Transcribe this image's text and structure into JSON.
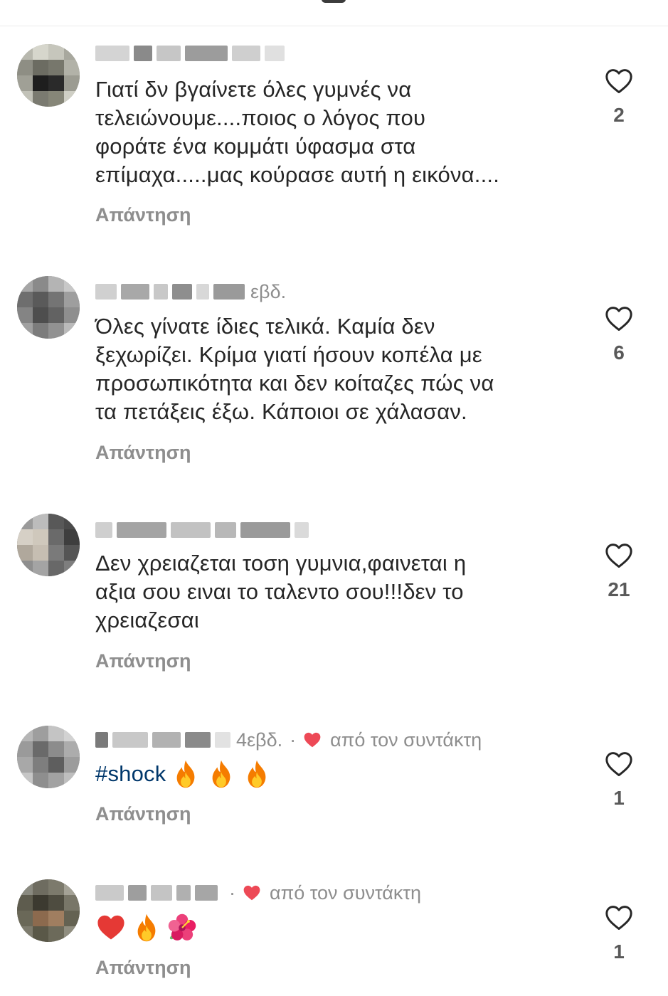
{
  "comments": [
    {
      "timestamp": "",
      "text_lines": [
        "Γιατί δν βγαίνετε όλες γυμνές να",
        "τελειώνουμε....ποιος ο λόγος που",
        "φοράτε ένα κομμάτι ύφασμα στα",
        "επίμαχα.....μας κούρασε αυτή η εικόνα...."
      ],
      "reply_label": "Απάντηση",
      "like_count": "2"
    },
    {
      "timestamp": "εβδ.",
      "text_lines": [
        "Όλες γίνατε ίδιες τελικά. Καμία δεν",
        "ξεχωρίζει. Κρίμα γιατί ήσουν κοπέλα με",
        "προσωπικότητα και δεν κοίταζες πώς να",
        "τα πετάξεις έξω. Κάποιοι σε χάλασαν."
      ],
      "reply_label": "Απάντηση",
      "like_count": "6"
    },
    {
      "timestamp": "",
      "text_lines": [
        "Δεν χρειαζεται τοση γυμνια,φαινεται η",
        "αξια σου ειναι το ταλεντο σου!!!δεν το",
        "χρειαζεσαι"
      ],
      "reply_label": "Απάντηση",
      "like_count": "21"
    },
    {
      "timestamp": "4εβδ.",
      "separator": "·",
      "author_like_label": "από τον συντάκτη",
      "hashtag": "#shock",
      "emojis": [
        "fire-emoji",
        "fire-emoji",
        "fire-emoji"
      ],
      "reply_label": "Απάντηση",
      "like_count": "1"
    },
    {
      "timestamp": "",
      "separator": "·",
      "author_like_label": "από τον συντάκτη",
      "emojis": [
        "red-heart-emoji",
        "fire-emoji",
        "hibiscus-emoji"
      ],
      "reply_label": "Απάντηση",
      "like_count": "1"
    }
  ],
  "colors": {
    "text": "#262626",
    "secondary": "#8e8e8e",
    "hashtag": "#00376b",
    "heart_red": "#ed4956"
  }
}
